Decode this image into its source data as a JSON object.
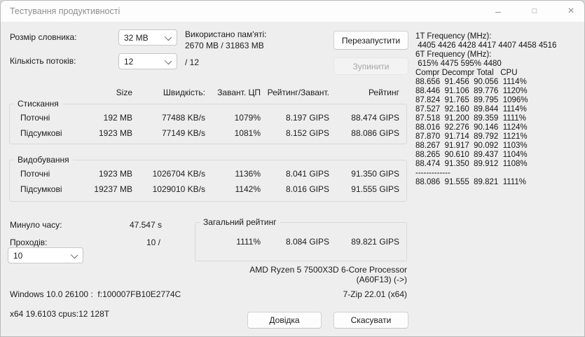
{
  "titlebar": {
    "title": "Тестування продуктивності",
    "minimize_icon": "–",
    "maximize_icon": "□",
    "close_icon": "×"
  },
  "controls": {
    "dictionary_label": "Розмір словника:",
    "dictionary_value": "32 MB",
    "memory_label": "Використано пам'яті:",
    "memory_value": "2670 MB / 31863 MB",
    "threads_label": "Кількість потоків:",
    "threads_value": "12",
    "threads_suffix": "/ 12",
    "restart_button": "Перезапустити",
    "stop_button": "Зупинити"
  },
  "cpu_info_panel": {
    "lines": [
      "1T Frequency (MHz):",
      " 4405 4426 4428 4417 4407 4458 4516",
      "6T Frequency (MHz):",
      " 615% 4475 595% 4480",
      "Compr Decompr Total   CPU",
      "88.656  91.456  90.056  1114%",
      "88.446  91.106  89.776  1120%",
      "87.824  91.765  89.795  1096%",
      "87.527  92.160  89.844  1114%",
      "87.518  91.200  89.359  1111%",
      "88.016  92.276  90.146  1124%",
      "87.870  91.714  89.792  1121%",
      "88.267  91.917  90.092  1103%",
      "88.265  90.610  89.437  1104%",
      "88.474  91.350  89.912  1108%",
      "-------------",
      "88.086  91.555  89.821  1111%"
    ]
  },
  "table": {
    "headers": [
      "Size",
      "Швидкість:",
      "Завант. ЦП",
      "Рейтинг/Завант.",
      "Рейтинг"
    ],
    "groups": [
      {
        "title": "Стискання",
        "rows": [
          {
            "label": "Поточні",
            "cells": [
              "192 MB",
              "77488 KB/s",
              "1079%",
              "8.197 GIPS",
              "88.474 GIPS"
            ]
          },
          {
            "label": "Підсумкові",
            "cells": [
              "1923 MB",
              "77149 KB/s",
              "1081%",
              "8.152 GIPS",
              "88.086 GIPS"
            ]
          }
        ]
      },
      {
        "title": "Видобування",
        "rows": [
          {
            "label": "Поточні",
            "cells": [
              "1923 MB",
              "1026704 KB/s",
              "1136%",
              "8.041 GIPS",
              "91.350 GIPS"
            ]
          },
          {
            "label": "Підсумкові",
            "cells": [
              "19237 MB",
              "1029010 KB/s",
              "1142%",
              "8.016 GIPS",
              "91.555 GIPS"
            ]
          }
        ]
      }
    ]
  },
  "status": {
    "elapsed_label": "Минуло часу:",
    "elapsed_value": "47.547 s",
    "passes_label": "Проходів:",
    "passes_value": "10 /",
    "passes_dropdown": "10",
    "total_group_title": "Загальний рейтинг",
    "total_cells": [
      "1111%",
      "8.084 GIPS",
      "89.821 GIPS"
    ]
  },
  "footer": {
    "cpu_name": "AMD Ryzen 5 7500X3D 6-Core Processor",
    "cpu_id": "(A60F13) (->)",
    "os_info": "Windows 10.0 26100 :  f:100007FB10E2774C",
    "zip_version": "7-Zip 22.01 (x64)",
    "arch_info": "x64 19.6103 cpus:12 128T",
    "help_button": "Довідка",
    "cancel_button": "Скасувати"
  }
}
